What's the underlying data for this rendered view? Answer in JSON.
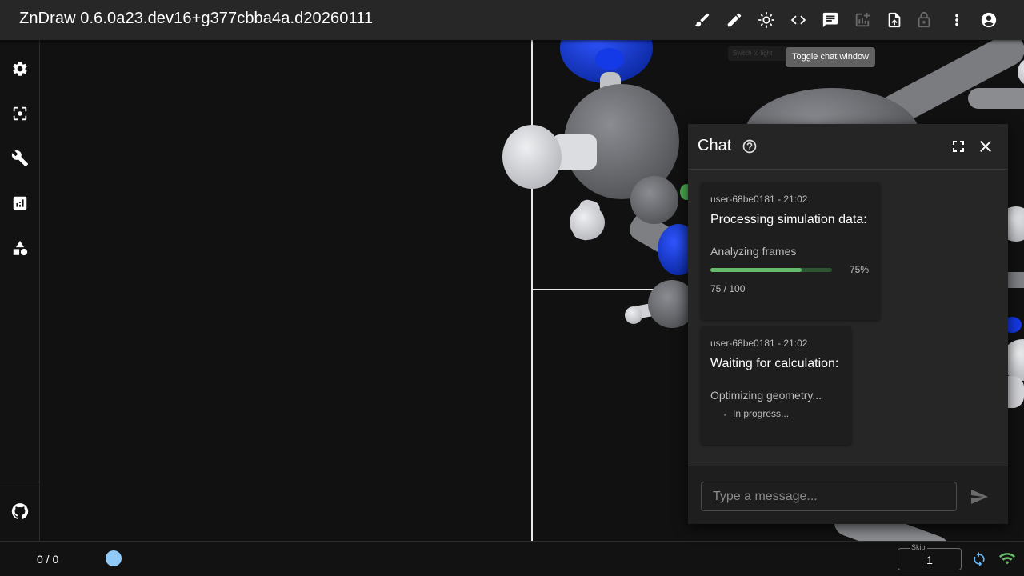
{
  "app": {
    "title": "ZnDraw 0.6.0a23.dev16+g377cbba4a.d20260111"
  },
  "toolbar": {
    "icons": [
      "brush-icon",
      "pencil-icon",
      "brightness-icon",
      "code-icon",
      "chat-icon",
      "add-chart-icon",
      "upload-file-icon",
      "lock-icon",
      "more-vert-icon",
      "account-icon"
    ],
    "tooltip": "Toggle chat window",
    "ghost_tooltip": "Switch to light"
  },
  "sidebar": {
    "icons": [
      "settings-icon",
      "center-focus-icon",
      "build-icon",
      "analytics-icon",
      "category-icon",
      "github-icon"
    ]
  },
  "chat": {
    "title": "Chat",
    "input_placeholder": "Type a message...",
    "messages": [
      {
        "meta": "user-68be0181 - 21:02",
        "heading": "Processing simulation data:",
        "sub": "Analyzing frames",
        "progress_fraction": 0.75,
        "progress_pct": "75%",
        "progress_count": "75 / 100"
      },
      {
        "meta": "user-68be0181 - 21:02",
        "heading": "Waiting for calculation:",
        "sub": "Optimizing geometry...",
        "status": "In progress..."
      }
    ]
  },
  "bottom": {
    "frame_counter": "0 / 0",
    "skip_label": "Skip",
    "skip_value": "1"
  },
  "colors": {
    "accent_blue": "#90caf9",
    "progress_green": "#66bb6a",
    "wifi_green": "#66bb6a",
    "atom_blue": "#1a3fcf",
    "atom_grey": "#6e7075",
    "atom_white": "#d8d9dc"
  }
}
